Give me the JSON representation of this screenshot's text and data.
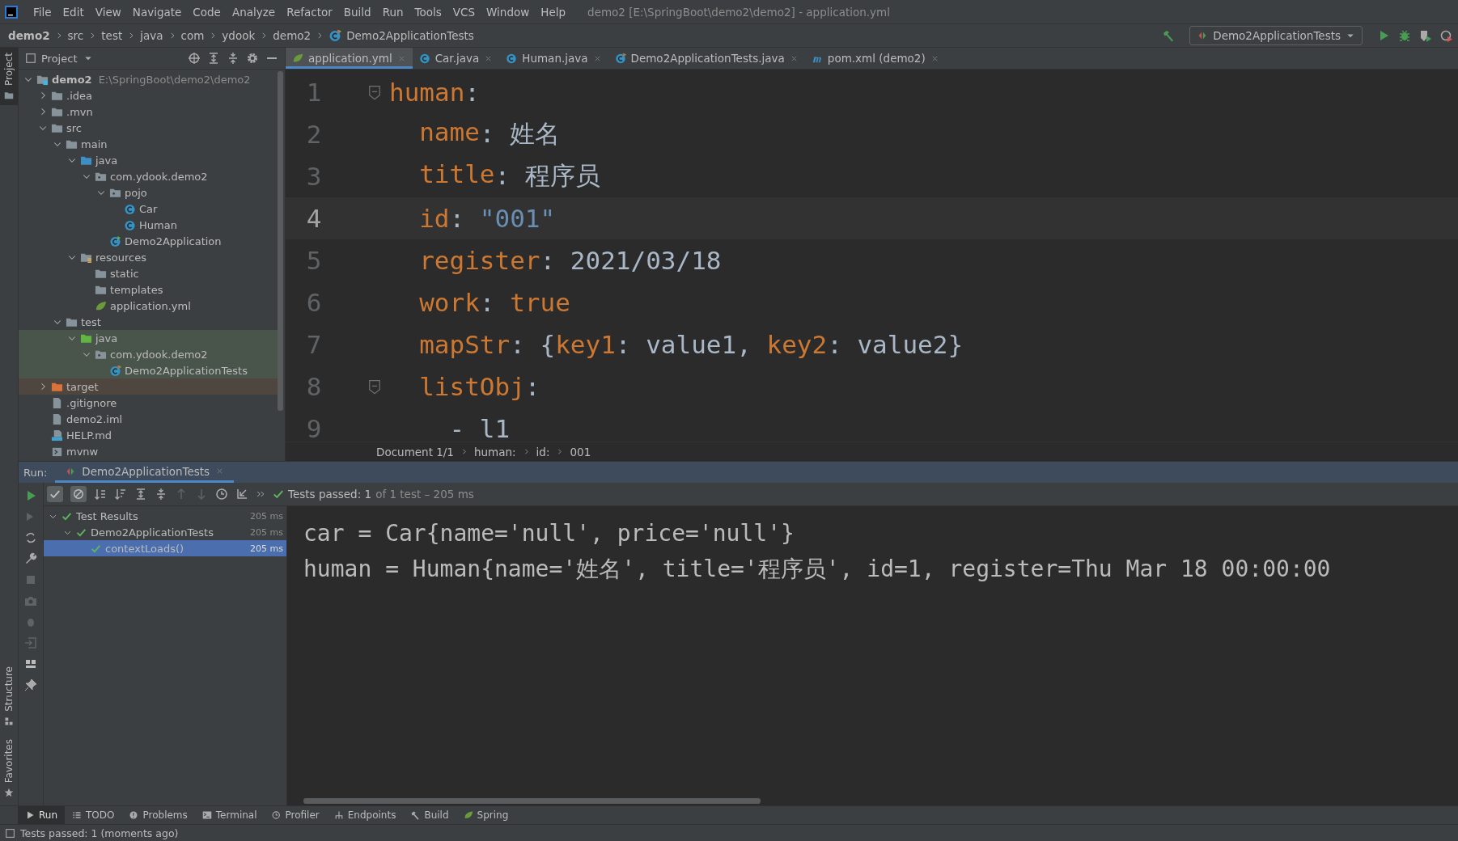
{
  "menu_bar": {
    "items": [
      "File",
      "Edit",
      "View",
      "Navigate",
      "Code",
      "Analyze",
      "Refactor",
      "Build",
      "Run",
      "Tools",
      "VCS",
      "Window",
      "Help"
    ],
    "title": "demo2 [E:\\SpringBoot\\demo2\\demo2] - application.yml"
  },
  "nav_bar": {
    "crumbs": [
      "demo2",
      "src",
      "test",
      "java",
      "com",
      "ydook",
      "demo2",
      "Demo2ApplicationTests"
    ],
    "run_config": "Demo2ApplicationTests"
  },
  "side_stripe": {
    "top": [
      "Project"
    ],
    "bottom": [
      "Structure",
      "Favorites"
    ]
  },
  "project_panel": {
    "title": "Project",
    "tree": [
      {
        "name": "demo2",
        "path": "E:\\SpringBoot\\demo2\\demo2",
        "kind": "module",
        "expanded": true,
        "children": [
          {
            "name": ".idea",
            "kind": "folder",
            "expanded": false
          },
          {
            "name": ".mvn",
            "kind": "folder",
            "expanded": false
          },
          {
            "name": "src",
            "kind": "folder",
            "expanded": true,
            "children": [
              {
                "name": "main",
                "kind": "folder",
                "expanded": true,
                "children": [
                  {
                    "name": "java",
                    "kind": "source-folder",
                    "expanded": true,
                    "children": [
                      {
                        "name": "com.ydook.demo2",
                        "kind": "package",
                        "expanded": true,
                        "children": [
                          {
                            "name": "pojo",
                            "kind": "package",
                            "expanded": true,
                            "children": [
                              {
                                "name": "Car",
                                "kind": "class"
                              },
                              {
                                "name": "Human",
                                "kind": "class"
                              }
                            ]
                          },
                          {
                            "name": "Demo2Application",
                            "kind": "spring-class"
                          }
                        ]
                      }
                    ]
                  },
                  {
                    "name": "resources",
                    "kind": "resources-folder",
                    "expanded": true,
                    "children": [
                      {
                        "name": "static",
                        "kind": "folder"
                      },
                      {
                        "name": "templates",
                        "kind": "folder"
                      },
                      {
                        "name": "application.yml",
                        "kind": "yml"
                      }
                    ]
                  }
                ]
              },
              {
                "name": "test",
                "kind": "folder",
                "expanded": true,
                "children": [
                  {
                    "name": "java",
                    "kind": "test-folder",
                    "expanded": true,
                    "children": [
                      {
                        "name": "com.ydook.demo2",
                        "kind": "test-package",
                        "expanded": true,
                        "children": [
                          {
                            "name": "Demo2ApplicationTests",
                            "kind": "test-class"
                          }
                        ]
                      }
                    ]
                  }
                ]
              }
            ]
          },
          {
            "name": "target",
            "kind": "excluded-folder",
            "expanded": false
          },
          {
            "name": ".gitignore",
            "kind": "file"
          },
          {
            "name": "demo2.iml",
            "kind": "file"
          },
          {
            "name": "HELP.md",
            "kind": "md-file"
          },
          {
            "name": "mvnw",
            "kind": "script-file"
          }
        ]
      }
    ]
  },
  "editor_tabs": [
    {
      "label": "application.yml",
      "kind": "yml",
      "selected": true
    },
    {
      "label": "Car.java",
      "kind": "class",
      "selected": false
    },
    {
      "label": "Human.java",
      "kind": "class",
      "selected": false
    },
    {
      "label": "Demo2ApplicationTests.java",
      "kind": "test-class",
      "selected": false
    },
    {
      "label": "pom.xml (demo2)",
      "kind": "maven",
      "selected": false
    }
  ],
  "editor": {
    "lines": [
      {
        "number": "1",
        "current": false,
        "fold": true,
        "kind": "top",
        "tokens": [
          {
            "kind": "key",
            "text": "human"
          },
          {
            "kind": "plain",
            "text": ":"
          }
        ]
      },
      {
        "number": "2",
        "current": false,
        "fold": false,
        "kind": "child",
        "tokens": [
          {
            "kind": "key",
            "text": "name"
          },
          {
            "kind": "plain",
            "text": ": 姓名"
          }
        ]
      },
      {
        "number": "3",
        "current": false,
        "fold": false,
        "kind": "child",
        "tokens": [
          {
            "kind": "key",
            "text": "title"
          },
          {
            "kind": "plain",
            "text": ": 程序员"
          }
        ]
      },
      {
        "number": "4",
        "current": true,
        "fold": false,
        "kind": "child",
        "tokens": [
          {
            "kind": "key",
            "text": "id"
          },
          {
            "kind": "plain",
            "text": ": "
          },
          {
            "kind": "string",
            "text": "\"001\""
          }
        ]
      },
      {
        "number": "5",
        "current": false,
        "fold": false,
        "kind": "child",
        "tokens": [
          {
            "kind": "key",
            "text": "register"
          },
          {
            "kind": "plain",
            "text": ": 2021/03/18"
          }
        ]
      },
      {
        "number": "6",
        "current": false,
        "fold": false,
        "kind": "child",
        "tokens": [
          {
            "kind": "key",
            "text": "work"
          },
          {
            "kind": "plain",
            "text": ": "
          },
          {
            "kind": "keyword",
            "text": "true"
          }
        ]
      },
      {
        "number": "7",
        "current": false,
        "fold": false,
        "kind": "child",
        "tokens": [
          {
            "kind": "key",
            "text": "mapStr"
          },
          {
            "kind": "plain",
            "text": ": {"
          },
          {
            "kind": "key",
            "text": "key1"
          },
          {
            "kind": "plain",
            "text": ": value1, "
          },
          {
            "kind": "key",
            "text": "key2"
          },
          {
            "kind": "plain",
            "text": ": value2}"
          }
        ]
      },
      {
        "number": "8",
        "current": false,
        "fold": true,
        "kind": "child",
        "tokens": [
          {
            "kind": "key",
            "text": "listObj"
          },
          {
            "kind": "plain",
            "text": ":"
          }
        ]
      },
      {
        "number": "9",
        "current": false,
        "fold": false,
        "kind": "list-item",
        "tokens": [
          {
            "kind": "plain",
            "text": "- l1"
          }
        ]
      }
    ],
    "breadcrumb": [
      "Document 1/1",
      "human:",
      "id:",
      "001"
    ]
  },
  "run_panel": {
    "label": "Run:",
    "tab": "Demo2ApplicationTests",
    "status": "Tests passed: 1",
    "status_detail": "of 1 test – 205 ms",
    "results": [
      {
        "name": "Test Results",
        "time": "205 ms",
        "selected": false,
        "children": [
          {
            "name": "Demo2ApplicationTests",
            "time": "205 ms",
            "selected": false,
            "children": [
              {
                "name": "contextLoads()",
                "time": "205 ms",
                "selected": true
              }
            ]
          }
        ]
      }
    ],
    "console": [
      "car = Car{name='null', price='null'}",
      "human = Human{name='姓名', title='程序员', id=1, register=Thu Mar 18 00:00:00"
    ]
  },
  "tool_tabs": [
    {
      "label": "Run",
      "kind": "run",
      "selected": true
    },
    {
      "label": "TODO",
      "kind": "list",
      "selected": false
    },
    {
      "label": "Problems",
      "kind": "problem",
      "selected": false
    },
    {
      "label": "Terminal",
      "kind": "terminal",
      "selected": false
    },
    {
      "label": "Profiler",
      "kind": "profiler",
      "selected": false
    },
    {
      "label": "Endpoints",
      "kind": "endpoints",
      "selected": false
    },
    {
      "label": "Build",
      "kind": "hammer",
      "selected": false
    },
    {
      "label": "Spring",
      "kind": "leaf",
      "selected": false
    }
  ],
  "status_bar": {
    "text": "Tests passed: 1 (moments ago)"
  }
}
